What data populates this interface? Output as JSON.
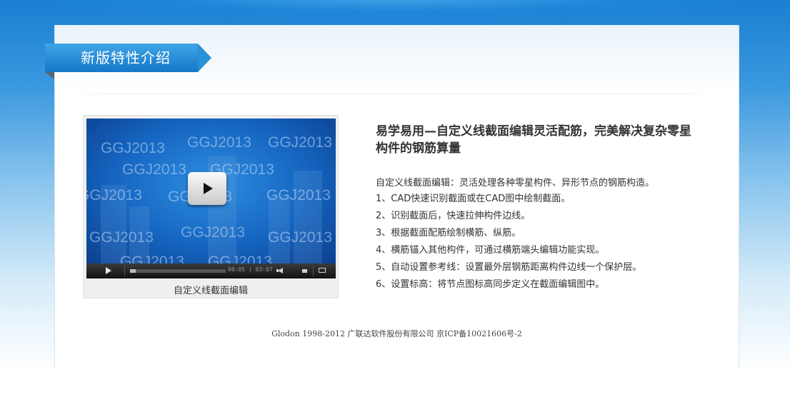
{
  "section": {
    "title": "新版特性介绍"
  },
  "video": {
    "watermark": "GGJ2013",
    "current_time": "00:05",
    "total_time": "03:07",
    "progress_fraction": 0.03,
    "caption": "自定义线截面编辑"
  },
  "article": {
    "headline": "易学易用—自定义线截面编辑灵活配筋，完美解决复杂零星构件的钢筋算量",
    "intro": "自定义线截面编辑：灵活处理各种零星构件、异形节点的钢筋构造。",
    "features": [
      "1、CAD快速识别截面或在CAD图中绘制截面。",
      "2、识别截面后，快速拉伸构件边线。",
      "3、根据截面配筋绘制横筋、纵筋。",
      "4、横筋锚入其他构件，可通过横筋端头编辑功能实现。",
      "5、自动设置参考线：设置最外层钢筋距离构件边线一个保护层。",
      "6、设置标高：将节点图标高同步定义在截面编辑图中。"
    ]
  },
  "footer": {
    "text": "Glodon 1998-2012 广联达软件股份有限公司 京ICP备10021606号-2"
  },
  "colors": {
    "brand_blue": "#1a7fd2",
    "ribbon_blue": "#2890d8",
    "text": "#333333"
  }
}
